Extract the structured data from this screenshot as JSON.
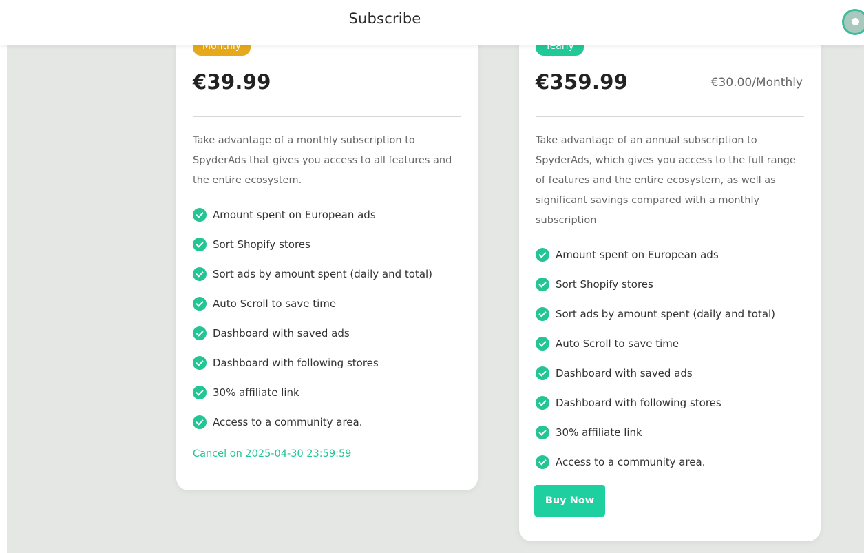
{
  "header": {
    "title": "Subscribe",
    "avatar_icon": "user-avatar-icon"
  },
  "plans": [
    {
      "badge": "Monthly",
      "price": "€39.99",
      "price_per": "",
      "description": "Take advantage of a monthly subscription to SpyderAds that gives you access to all features and the entire ecosystem.",
      "features": [
        "Amount spent on European ads",
        "Sort Shopify stores",
        "Sort ads by amount spent (daily and total)",
        "Auto Scroll to save time",
        "Dashboard with saved ads",
        "Dashboard with following stores",
        "30% affiliate link",
        "Access to a community area."
      ],
      "status_text": "Cancel on 2025-04-30 23:59:59"
    },
    {
      "badge": "Yearly",
      "price": "€359.99",
      "price_per": "€30.00/Monthly",
      "description": "Take advantage of an annual subscription to SpyderAds, which gives you access to the full range of features and the entire ecosystem, as well as significant savings compared with a monthly subscription",
      "features": [
        "Amount spent on European ads",
        "Sort Shopify stores",
        "Sort ads by amount spent (daily and total)",
        "Auto Scroll to save time",
        "Dashboard with saved ads",
        "Dashboard with following stores",
        "30% affiliate link",
        "Access to a community area."
      ],
      "buy_label": "Buy Now"
    }
  ],
  "colors": {
    "accent": "#22c593",
    "monthly_badge": "#e7a91c",
    "yearly_badge": "#20c997",
    "background": "#e5e7e5"
  }
}
